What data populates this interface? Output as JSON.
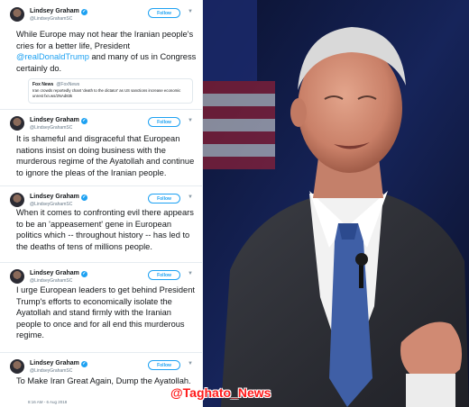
{
  "tweets": [
    {
      "name": "Lindsey Graham",
      "handle": "@LindseyGrahamSC",
      "follow_label": "Follow",
      "text_before": "While Europe may not hear the Iranian people's cries for a better life, President ",
      "mention": "@realDonaldTrump",
      "text_after": " and many of us in Congress certainly do.",
      "quote": {
        "name": "Fox News",
        "handle": "@FoxNews",
        "text": "Iran crowds reportedly chant 'death to the dictator' as US sanctions increase economic unrest fxn.ws/2NAd83k"
      }
    },
    {
      "name": "Lindsey Graham",
      "handle": "@LindseyGrahamSC",
      "follow_label": "Follow",
      "text": "It is shameful and disgraceful that European nations insist on doing business with the murderous regime of the Ayatollah and continue to ignore the pleas of the Iranian people."
    },
    {
      "name": "Lindsey Graham",
      "handle": "@LindseyGrahamSC",
      "follow_label": "Follow",
      "text": "When it comes to confronting evil there appears to be an 'appeasement' gene in European politics which -- throughout history -- has led to the deaths of tens of millions people."
    },
    {
      "name": "Lindsey Graham",
      "handle": "@LindseyGrahamSC",
      "follow_label": "Follow",
      "text": "I urge European leaders to get behind President Trump's efforts to economically isolate the Ayatollah and stand firmly with the Iranian people to once and for all end this murderous regime."
    },
    {
      "name": "Lindsey Graham",
      "handle": "@LindseyGrahamSC",
      "follow_label": "Follow",
      "text": "To Make Iran Great Again, Dump the Ayatollah."
    }
  ],
  "timestamp": "8:16 AM - 6 Aug 2018",
  "watermark": "@Taghato_News",
  "icons": {
    "verified": "verified-badge-icon",
    "caret": "chevron-down-icon"
  },
  "colors": {
    "link": "#1da1f2",
    "text": "#14171a",
    "muted": "#657786",
    "watermark": "#ff1a1a"
  }
}
